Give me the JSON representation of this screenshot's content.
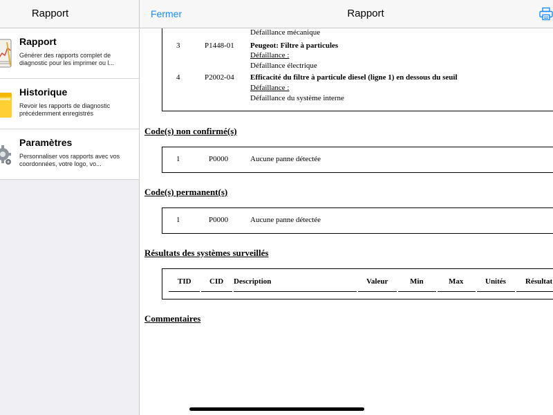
{
  "sidebar": {
    "title": "Rapport",
    "items": [
      {
        "title": "Rapport",
        "subtitle": "Générer des rapports complet de diagnostic pour les imprimer ou l..."
      },
      {
        "title": "Historique",
        "subtitle": "Revoir les rapports de diagnostic précédemment enregistrés"
      },
      {
        "title": "Paramètres",
        "subtitle": "Personnaliser vos rapports avec vos coordonnées, votre logo, vo..."
      }
    ]
  },
  "nav": {
    "close_label": "Fermer",
    "title": "Rapport",
    "print_icon": "printer-icon"
  },
  "report": {
    "confirmed_codes": [
      {
        "detail": "Défaillance mécanique"
      },
      {
        "index": "3",
        "code": "P1448-01",
        "title": "Peugeot: Filtre à particules",
        "fault_label": "Défaillance :",
        "detail": "Défaillance électrique"
      },
      {
        "index": "4",
        "code": "P2002-04",
        "title": "Efficacité du filtre à particule diesel (ligne 1) en dessous du seuil",
        "fault_label": "Défaillance :",
        "detail": "Défaillance du système interne"
      }
    ],
    "unconfirmed": {
      "heading": "Code(s) non confirmé(s)",
      "rows": [
        {
          "index": "1",
          "code": "P0000",
          "desc": "Aucune panne détectée"
        }
      ]
    },
    "permanent": {
      "heading": "Code(s) permanent(s)",
      "rows": [
        {
          "index": "1",
          "code": "P0000",
          "desc": "Aucune panne détectée"
        }
      ]
    },
    "monitor": {
      "heading": "Résultats des systèmes surveillés",
      "columns": [
        "TID",
        "CID",
        "Description",
        "Valeur",
        "Min",
        "Max",
        "Unités",
        "Résultat"
      ]
    },
    "comments_heading": "Commentaires"
  },
  "colors": {
    "accent": "#1a8cff",
    "bar": "#f7f7f7",
    "sidebar_bg": "#efeff4"
  }
}
